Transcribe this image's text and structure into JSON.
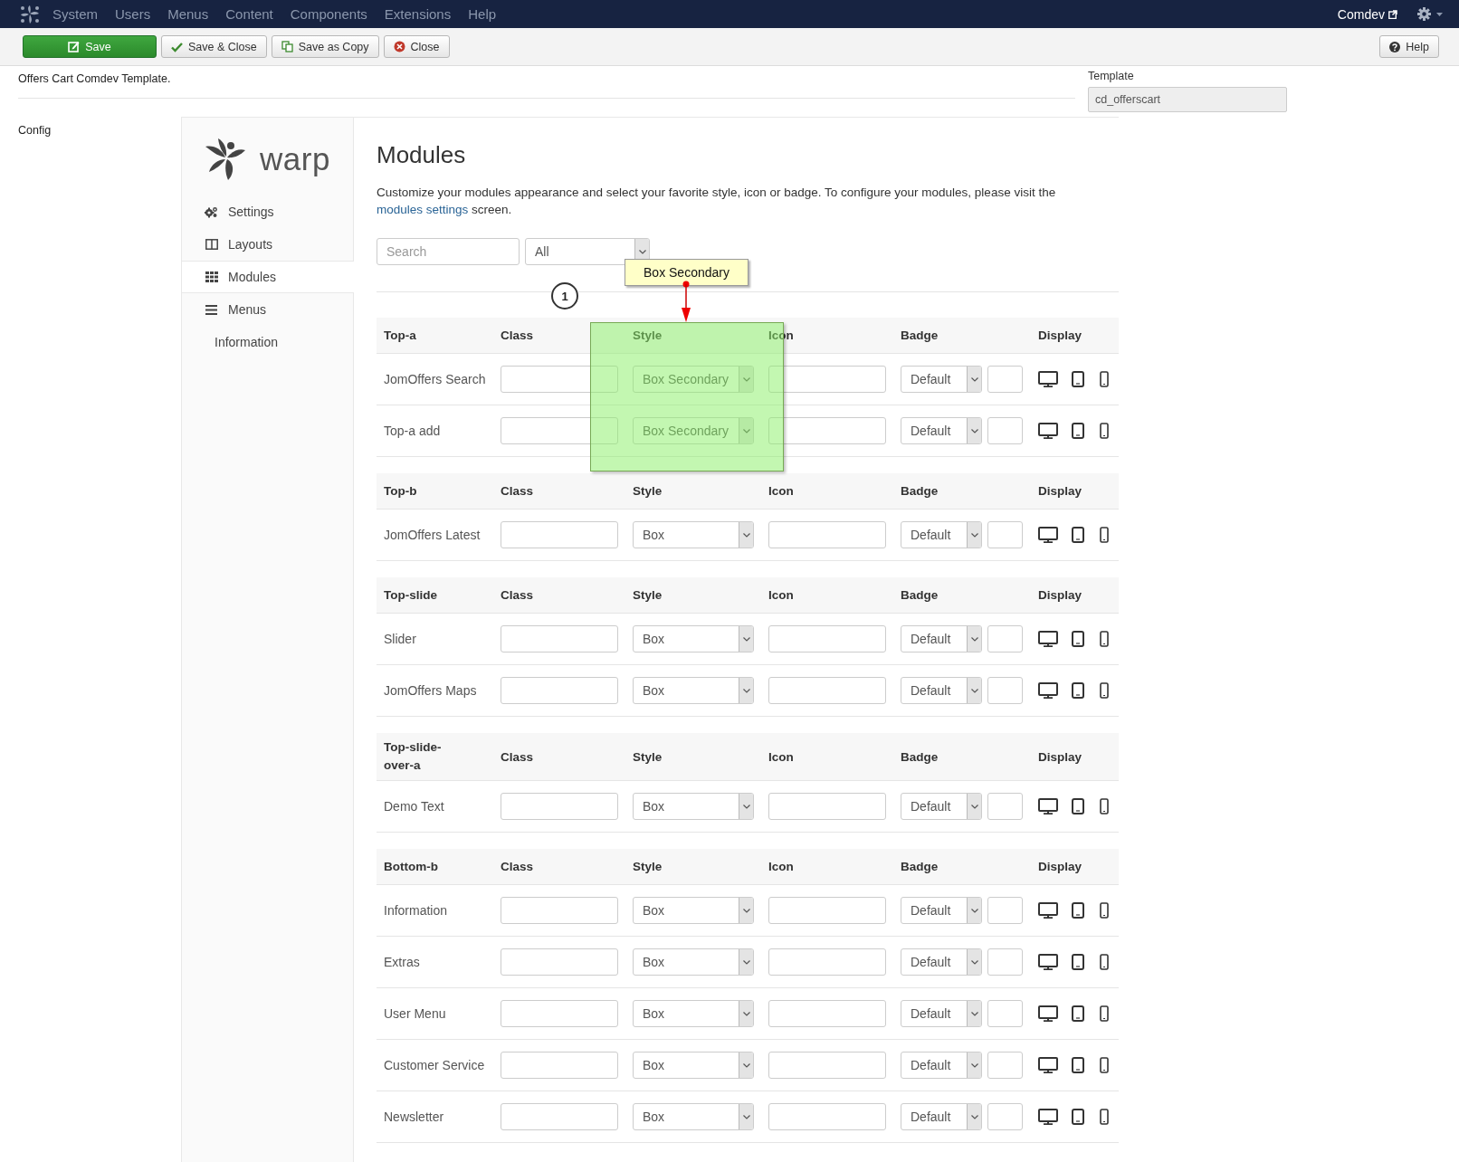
{
  "topbar": {
    "menu": [
      "System",
      "Users",
      "Menus",
      "Content",
      "Components",
      "Extensions",
      "Help"
    ],
    "user": "Comdev"
  },
  "toolbar": {
    "buttons": [
      {
        "label": "Save",
        "kind": "save"
      },
      {
        "label": "Save & Close",
        "kind": "check"
      },
      {
        "label": "Save as Copy",
        "kind": "copy"
      },
      {
        "label": "Close",
        "kind": "close"
      }
    ],
    "help": "Help"
  },
  "description": "Offers Cart Comdev Template.",
  "template_field": {
    "label": "Template",
    "value": "cd_offerscart"
  },
  "config_label": "Config",
  "sidebar": {
    "logo": "warp",
    "items": [
      {
        "label": "Settings",
        "kind": "settings",
        "selected": false
      },
      {
        "label": "Layouts",
        "kind": "layouts",
        "selected": false
      },
      {
        "label": "Modules",
        "kind": "modules",
        "selected": true
      },
      {
        "label": "Menus",
        "kind": "menus",
        "selected": false
      },
      {
        "label": "Information",
        "kind": "text",
        "selected": false
      }
    ]
  },
  "main": {
    "title": "Modules",
    "intro": "Customize your modules appearance and select your favorite style, icon or badge. To configure your modules, please visit the",
    "link": "modules settings",
    "intro_end": "screen.",
    "search": {
      "placeholder": "Search"
    },
    "filter": "All"
  },
  "groups": [
    {
      "position": "Top-a",
      "columns": [
        "Class",
        "Style",
        "Icon",
        "Badge",
        "Display"
      ],
      "modules": [
        {
          "name": "JomOffers Search",
          "style_choice": "Box Secondary",
          "badge": "Default"
        },
        {
          "name": "Top-a add",
          "style_choice": "Box Secondary",
          "badge": "Default"
        }
      ]
    },
    {
      "position": "Top-b",
      "columns": [
        "Class",
        "Style",
        "Icon",
        "Badge",
        "Display"
      ],
      "modules": [
        {
          "name": "JomOffers Latest",
          "style_choice": "Box",
          "badge": "Default"
        }
      ]
    },
    {
      "position": "Top-slide",
      "columns": [
        "Class",
        "Style",
        "Icon",
        "Badge",
        "Display"
      ],
      "modules": [
        {
          "name": "Slider",
          "style_choice": "Box",
          "badge": "Default"
        },
        {
          "name": "JomOffers Maps",
          "style_choice": "Box",
          "badge": "Default"
        }
      ]
    },
    {
      "position": "Top-slide-over-a",
      "columns": [
        "Class",
        "Style",
        "Icon",
        "Badge",
        "Display"
      ],
      "modules": [
        {
          "name": "Demo Text",
          "style_choice": "Box",
          "badge": "Default"
        }
      ]
    },
    {
      "position": "Bottom-b",
      "columns": [
        "Class",
        "Style",
        "Icon",
        "Badge",
        "Display"
      ],
      "modules": [
        {
          "name": "Information",
          "style_choice": "Box",
          "badge": "Default"
        },
        {
          "name": "Extras",
          "style_choice": "Box",
          "badge": "Default"
        },
        {
          "name": "User Menu",
          "style_choice": "Box",
          "badge": "Default"
        },
        {
          "name": "Customer Service",
          "style_choice": "Box",
          "badge": "Default"
        },
        {
          "name": "Newsletter",
          "style_choice": "Box",
          "badge": "Default"
        }
      ]
    }
  ],
  "annotation": {
    "callout": "Box Secondary",
    "step": "1"
  }
}
